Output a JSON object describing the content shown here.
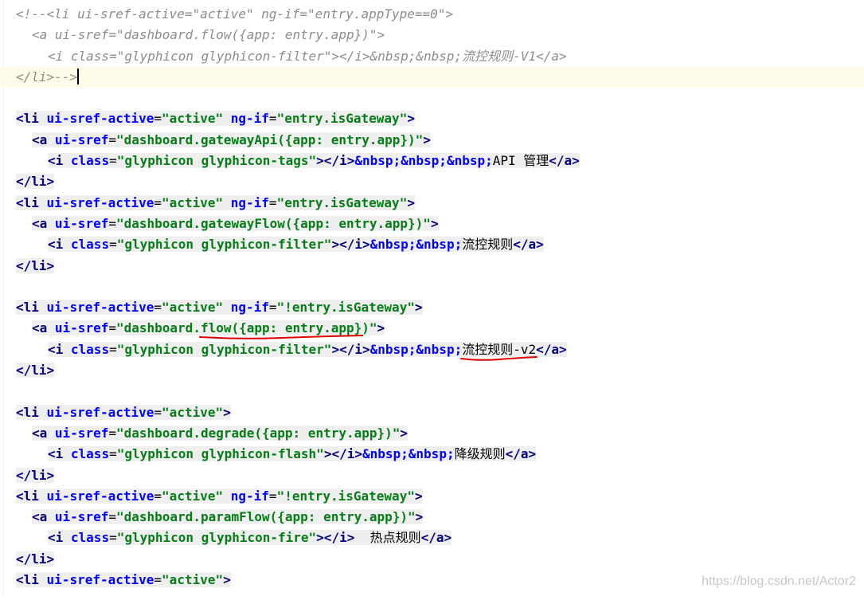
{
  "editor": {
    "lines": [
      {
        "indent": 0,
        "kind": "comment",
        "tokens": [
          [
            "comment",
            "<!--<li ui-sref-active=\"active\" ng-if=\"entry.appType==0\">"
          ]
        ]
      },
      {
        "indent": 1,
        "kind": "comment",
        "tokens": [
          [
            "comment",
            "<a ui-sref=\"dashboard.flow({app: entry.app})\">"
          ]
        ]
      },
      {
        "indent": 2,
        "kind": "comment",
        "tokens": [
          [
            "comment",
            "<i class=\"glyphicon glyphicon-filter\"></i>&nbsp;&nbsp;流控规则-V1</a>"
          ]
        ]
      },
      {
        "indent": 0,
        "kind": "comment",
        "current": true,
        "tokens": [
          [
            "comment",
            "</li>-->"
          ]
        ]
      },
      {
        "indent": 0,
        "kind": "blank",
        "tokens": []
      },
      {
        "indent": 0,
        "tokens": [
          [
            "tag",
            "<li"
          ],
          [
            "text",
            " "
          ],
          [
            "attr",
            "ui-sref-active"
          ],
          [
            "punct",
            "="
          ],
          [
            "str",
            "\"active\""
          ],
          [
            "text",
            " "
          ],
          [
            "attr",
            "ng-if"
          ],
          [
            "punct",
            "="
          ],
          [
            "str",
            "\"entry.isGateway\""
          ],
          [
            "tag",
            ">"
          ]
        ]
      },
      {
        "indent": 1,
        "tokens": [
          [
            "tag",
            "<a"
          ],
          [
            "text",
            " "
          ],
          [
            "attr",
            "ui-sref"
          ],
          [
            "punct",
            "="
          ],
          [
            "str",
            "\"dashboard.gatewayApi({app: entry.app})\""
          ],
          [
            "tag",
            ">"
          ]
        ]
      },
      {
        "indent": 2,
        "tokens": [
          [
            "tag",
            "<i"
          ],
          [
            "text",
            " "
          ],
          [
            "attr",
            "class"
          ],
          [
            "punct",
            "="
          ],
          [
            "str",
            "\"glyphicon glyphicon-tags\""
          ],
          [
            "tag",
            "></i>"
          ],
          [
            "ent",
            "&nbsp;&nbsp;&nbsp;"
          ],
          [
            "text",
            "API 管理"
          ],
          [
            "tag",
            "</a>"
          ]
        ]
      },
      {
        "indent": 0,
        "tokens": [
          [
            "tag",
            "</li>"
          ]
        ]
      },
      {
        "indent": 0,
        "tokens": [
          [
            "tag",
            "<li"
          ],
          [
            "text",
            " "
          ],
          [
            "attr",
            "ui-sref-active"
          ],
          [
            "punct",
            "="
          ],
          [
            "str",
            "\"active\""
          ],
          [
            "text",
            " "
          ],
          [
            "attr",
            "ng-if"
          ],
          [
            "punct",
            "="
          ],
          [
            "str",
            "\"entry.isGateway\""
          ],
          [
            "tag",
            ">"
          ]
        ]
      },
      {
        "indent": 1,
        "tokens": [
          [
            "tag",
            "<a"
          ],
          [
            "text",
            " "
          ],
          [
            "attr",
            "ui-sref"
          ],
          [
            "punct",
            "="
          ],
          [
            "str",
            "\"dashboard.gatewayFlow({app: entry.app})\""
          ],
          [
            "tag",
            ">"
          ]
        ]
      },
      {
        "indent": 2,
        "tokens": [
          [
            "tag",
            "<i"
          ],
          [
            "text",
            " "
          ],
          [
            "attr",
            "class"
          ],
          [
            "punct",
            "="
          ],
          [
            "str",
            "\"glyphicon glyphicon-filter\""
          ],
          [
            "tag",
            "></i>"
          ],
          [
            "ent",
            "&nbsp;&nbsp;"
          ],
          [
            "text",
            "流控规则"
          ],
          [
            "tag",
            "</a>"
          ]
        ]
      },
      {
        "indent": 0,
        "tokens": [
          [
            "tag",
            "</li>"
          ]
        ]
      },
      {
        "indent": 0,
        "kind": "blank",
        "tokens": []
      },
      {
        "indent": 0,
        "tokens": [
          [
            "tag",
            "<li"
          ],
          [
            "text",
            " "
          ],
          [
            "attr",
            "ui-sref-active"
          ],
          [
            "punct",
            "="
          ],
          [
            "str",
            "\"active\""
          ],
          [
            "text",
            " "
          ],
          [
            "attr",
            "ng-if"
          ],
          [
            "punct",
            "="
          ],
          [
            "str",
            "\"!entry.isGateway\""
          ],
          [
            "tag",
            ">"
          ]
        ]
      },
      {
        "indent": 1,
        "mark": "flow",
        "tokens": [
          [
            "tag",
            "<a"
          ],
          [
            "text",
            " "
          ],
          [
            "attr",
            "ui-sref"
          ],
          [
            "punct",
            "="
          ],
          [
            "str",
            "\"dashboard.flow({app: entry.app})\""
          ],
          [
            "tag",
            ">"
          ]
        ]
      },
      {
        "indent": 2,
        "mark": "rule-v2",
        "tokens": [
          [
            "tag",
            "<i"
          ],
          [
            "text",
            " "
          ],
          [
            "attr",
            "class"
          ],
          [
            "punct",
            "="
          ],
          [
            "str",
            "\"glyphicon glyphicon-filter\""
          ],
          [
            "tag",
            "></i>"
          ],
          [
            "ent",
            "&nbsp;&nbsp;"
          ],
          [
            "text",
            "流控规则-v2"
          ],
          [
            "tag",
            "</a>"
          ]
        ]
      },
      {
        "indent": 0,
        "tokens": [
          [
            "tag",
            "</li>"
          ]
        ]
      },
      {
        "indent": 0,
        "kind": "blank",
        "tokens": []
      },
      {
        "indent": 0,
        "tokens": [
          [
            "tag",
            "<li"
          ],
          [
            "text",
            " "
          ],
          [
            "attr",
            "ui-sref-active"
          ],
          [
            "punct",
            "="
          ],
          [
            "str",
            "\"active\""
          ],
          [
            "tag",
            ">"
          ]
        ]
      },
      {
        "indent": 1,
        "tokens": [
          [
            "tag",
            "<a"
          ],
          [
            "text",
            " "
          ],
          [
            "attr",
            "ui-sref"
          ],
          [
            "punct",
            "="
          ],
          [
            "str",
            "\"dashboard.degrade({app: entry.app})\""
          ],
          [
            "tag",
            ">"
          ]
        ]
      },
      {
        "indent": 2,
        "tokens": [
          [
            "tag",
            "<i"
          ],
          [
            "text",
            " "
          ],
          [
            "attr",
            "class"
          ],
          [
            "punct",
            "="
          ],
          [
            "str",
            "\"glyphicon glyphicon-flash\""
          ],
          [
            "tag",
            "></i>"
          ],
          [
            "ent",
            "&nbsp;&nbsp;"
          ],
          [
            "text",
            "降级规则"
          ],
          [
            "tag",
            "</a>"
          ]
        ]
      },
      {
        "indent": 0,
        "tokens": [
          [
            "tag",
            "</li>"
          ]
        ]
      },
      {
        "indent": 0,
        "tokens": [
          [
            "tag",
            "<li"
          ],
          [
            "text",
            " "
          ],
          [
            "attr",
            "ui-sref-active"
          ],
          [
            "punct",
            "="
          ],
          [
            "str",
            "\"active\""
          ],
          [
            "text",
            " "
          ],
          [
            "attr",
            "ng-if"
          ],
          [
            "punct",
            "="
          ],
          [
            "str",
            "\"!entry.isGateway\""
          ],
          [
            "tag",
            ">"
          ]
        ]
      },
      {
        "indent": 1,
        "tokens": [
          [
            "tag",
            "<a"
          ],
          [
            "text",
            " "
          ],
          [
            "attr",
            "ui-sref"
          ],
          [
            "punct",
            "="
          ],
          [
            "str",
            "\"dashboard.paramFlow({app: entry.app})\""
          ],
          [
            "tag",
            ">"
          ]
        ]
      },
      {
        "indent": 2,
        "tokens": [
          [
            "tag",
            "<i"
          ],
          [
            "text",
            " "
          ],
          [
            "attr",
            "class"
          ],
          [
            "punct",
            "="
          ],
          [
            "str",
            "\"glyphicon glyphicon-fire\""
          ],
          [
            "tag",
            "></i>"
          ],
          [
            "text",
            "  热点规则"
          ],
          [
            "tag",
            "</a>"
          ]
        ]
      },
      {
        "indent": 0,
        "tokens": [
          [
            "tag",
            "</li>"
          ]
        ]
      },
      {
        "indent": 0,
        "tokens": [
          [
            "tag",
            "<li"
          ],
          [
            "text",
            " "
          ],
          [
            "attr",
            "ui-sref-active"
          ],
          [
            "punct",
            "="
          ],
          [
            "str",
            "\"active\""
          ],
          [
            "tag",
            ">"
          ]
        ]
      }
    ]
  },
  "watermark": "https://blog.csdn.net/Actor2",
  "colors": {
    "underline": "#e00000",
    "current_line": "#fefce8"
  }
}
